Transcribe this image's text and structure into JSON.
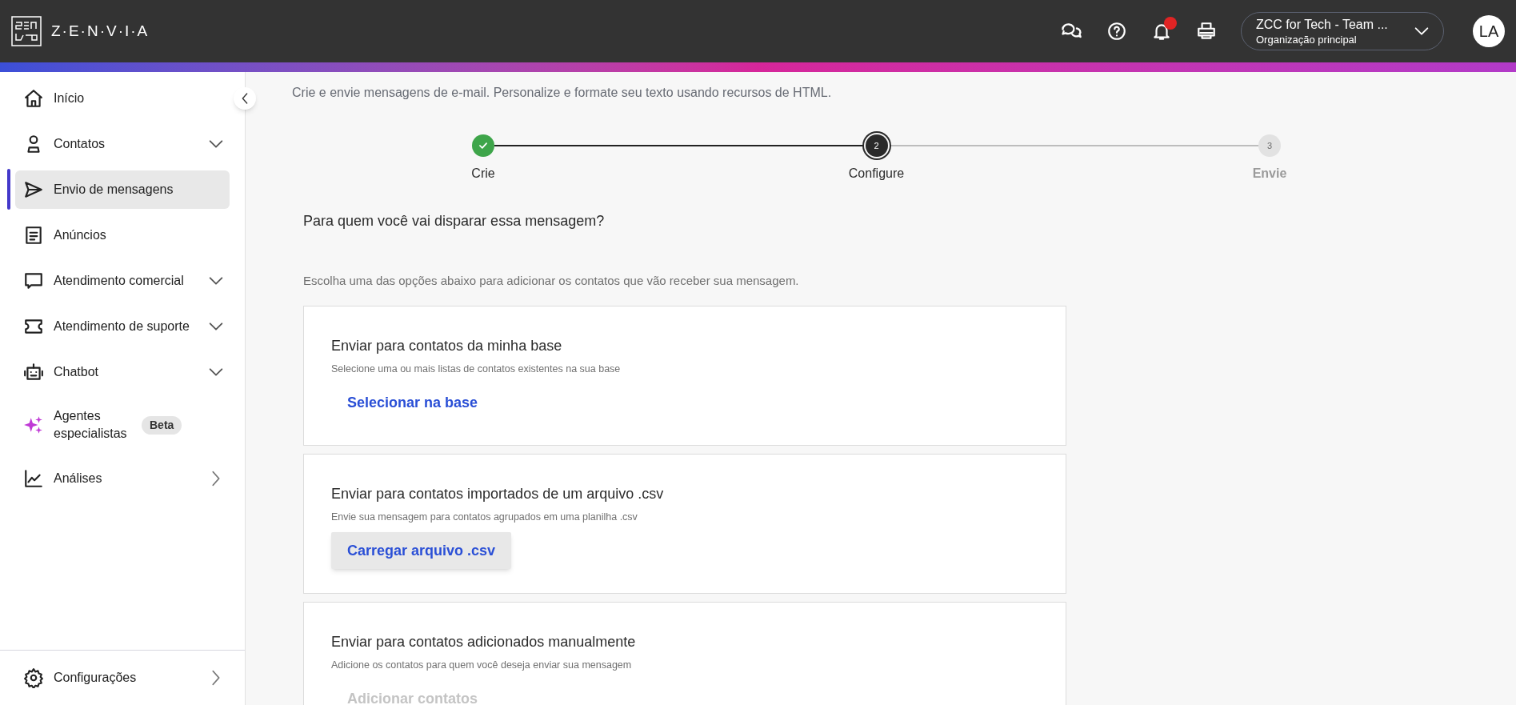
{
  "header": {
    "logo_text": "Z·E·N·V·I·A",
    "has_notification": true,
    "org": {
      "name": "ZCC for Tech - Team ...",
      "subtitle": "Organização principal"
    },
    "avatar": "LA"
  },
  "sidebar": {
    "items": [
      {
        "label": "Início",
        "kind": "link",
        "selected": false
      },
      {
        "label": "Contatos",
        "kind": "group",
        "selected": false
      },
      {
        "label": "Envio de mensagens",
        "kind": "link",
        "selected": true
      },
      {
        "label": "Anúncios",
        "kind": "link",
        "selected": false
      },
      {
        "label": "Atendimento comercial",
        "kind": "group",
        "selected": false
      },
      {
        "label": "Atendimento de suporte",
        "kind": "group",
        "selected": false
      },
      {
        "label": "Chatbot",
        "kind": "group",
        "selected": false
      },
      {
        "label": "Agentes especialistas",
        "kind": "link",
        "selected": false,
        "badge": "Beta"
      },
      {
        "label": "Análises",
        "kind": "submenu",
        "selected": false
      }
    ],
    "footer_item": {
      "label": "Configurações",
      "kind": "submenu"
    }
  },
  "main": {
    "subtitle": "Crie e envie mensagens de e-mail. Personalize e formate seu texto usando recursos de HTML.",
    "steps": [
      {
        "label": "Crie",
        "kind": "done"
      },
      {
        "number": "2",
        "label": "Configure",
        "kind": "current"
      },
      {
        "number": "3",
        "label": "Envie",
        "kind": "pending"
      }
    ],
    "question": "Para quem você vai disparar essa mensagem?",
    "instruction": "Escolha uma das opções abaixo para adicionar os contatos que vão receber sua mensagem.",
    "options": [
      {
        "title": "Enviar para contatos da minha base",
        "description": "Selecione uma ou mais listas de contatos existentes na sua base",
        "action": "Selecionar na base",
        "disabled": false,
        "hovered": false
      },
      {
        "title": "Enviar para contatos importados de um arquivo .csv",
        "description": "Envie sua mensagem para contatos agrupados em uma planilha .csv",
        "action": "Carregar arquivo .csv",
        "disabled": false,
        "hovered": true
      },
      {
        "title": "Enviar para contatos adicionados manualmente",
        "description": "Adicione os contatos para quem você deseja enviar sua mensagem",
        "action": "Adicionar contatos",
        "disabled": true,
        "hovered": false
      }
    ]
  }
}
